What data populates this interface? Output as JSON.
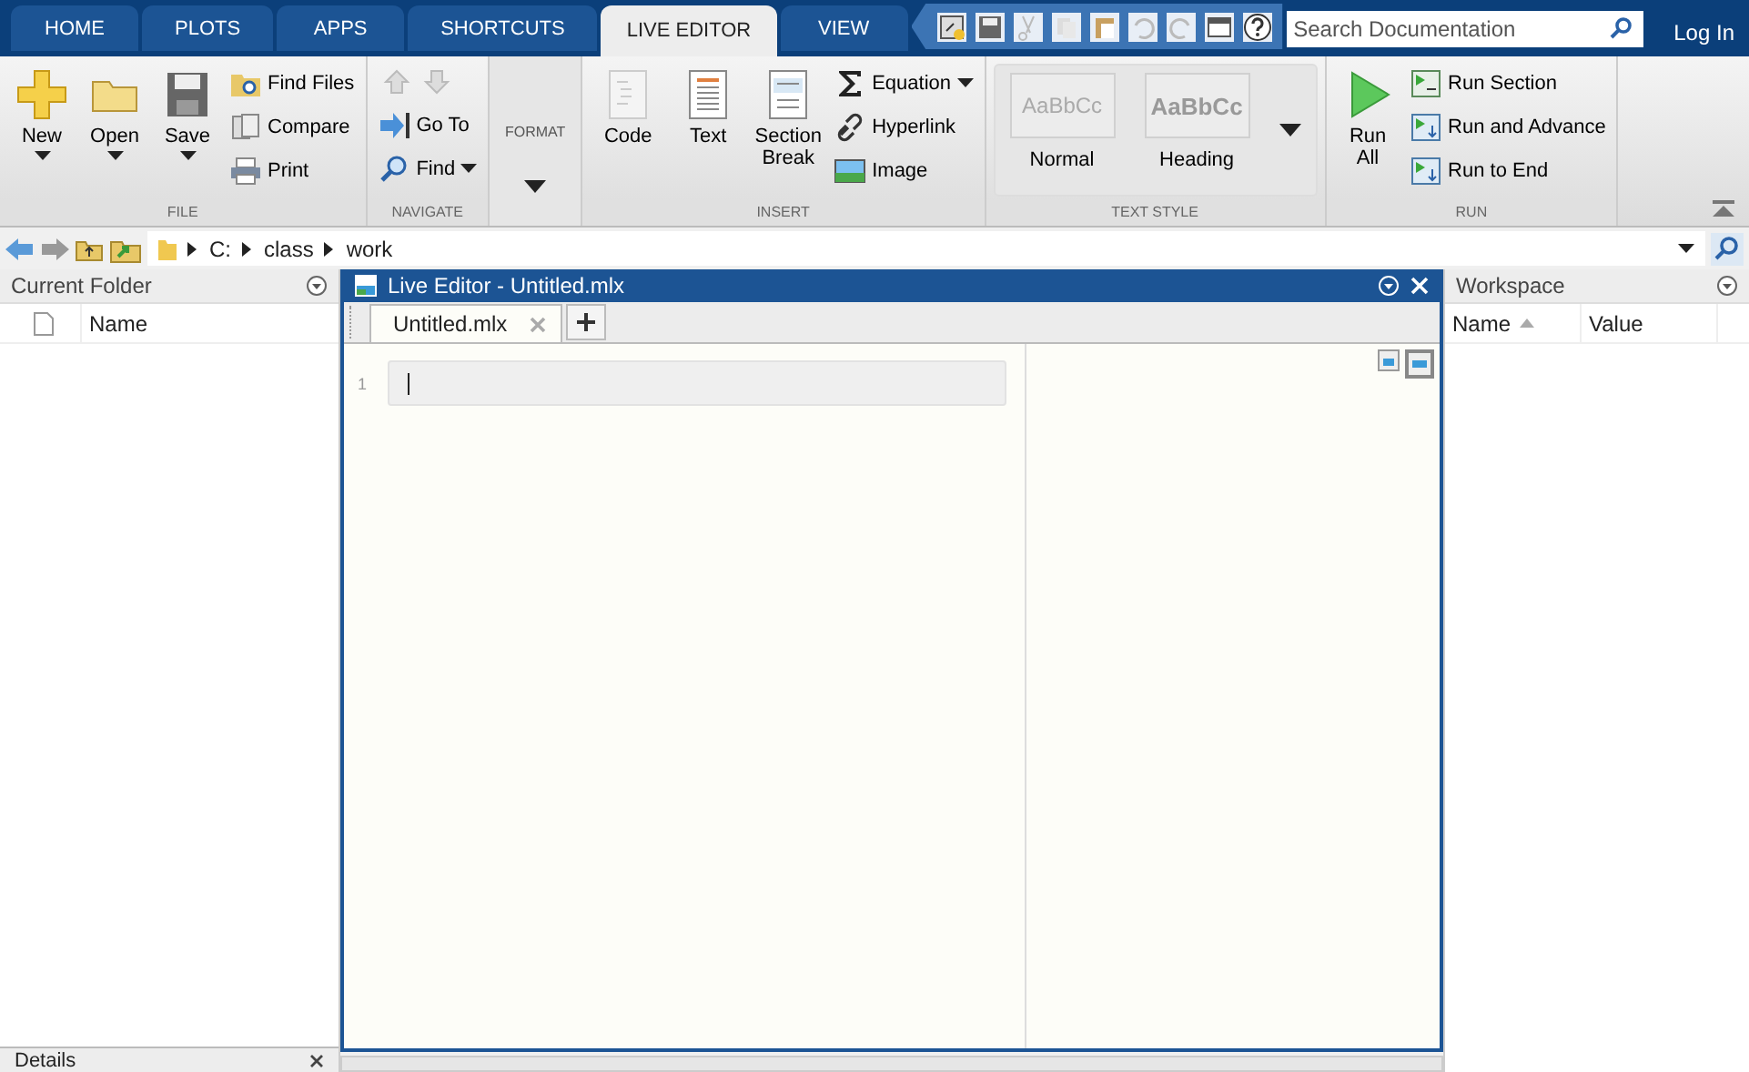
{
  "tabs": [
    {
      "label": "HOME",
      "selected": false
    },
    {
      "label": "PLOTS",
      "selected": false
    },
    {
      "label": "APPS",
      "selected": false
    },
    {
      "label": "SHORTCUTS",
      "selected": false
    },
    {
      "label": "LIVE EDITOR",
      "selected": true
    },
    {
      "label": "VIEW",
      "selected": false
    }
  ],
  "search": {
    "placeholder": "Search Documentation"
  },
  "login": "Log In",
  "ribbon": {
    "groups": [
      {
        "kind": "file",
        "title": "FILE",
        "large": [
          {
            "label": "New",
            "dropdown": true
          },
          {
            "label": "Open",
            "dropdown": true
          },
          {
            "label": "Save",
            "dropdown": true
          }
        ],
        "small": [
          {
            "label": "Find Files",
            "dropdown": false
          },
          {
            "label": "Compare",
            "dropdown": false
          },
          {
            "label": "Print",
            "dropdown": false
          }
        ]
      },
      {
        "kind": "navigate",
        "title": "NAVIGATE",
        "small": [
          {
            "label": "Go To",
            "dropdown": false
          },
          {
            "label": "Find",
            "dropdown": true
          }
        ]
      },
      {
        "kind": "format",
        "label": "FORMAT"
      },
      {
        "kind": "insert",
        "title": "INSERT",
        "large": [
          {
            "label": "Code",
            "dropdown": false
          },
          {
            "label": "Text",
            "dropdown": false
          },
          {
            "label": "Section Break",
            "dropdown": false
          }
        ],
        "small": [
          {
            "label": "Equation",
            "dropdown": true
          },
          {
            "label": "Hyperlink",
            "dropdown": false
          },
          {
            "label": "Image",
            "dropdown": false
          }
        ]
      },
      {
        "kind": "text_style",
        "title": "TEXT STYLE",
        "styles": [
          {
            "sample": "AaBbCc",
            "label": "Normal"
          },
          {
            "sample": "AaBbCc",
            "label": "Heading"
          }
        ]
      },
      {
        "kind": "run",
        "title": "RUN",
        "large": [
          {
            "label": "Run All",
            "dropdown": false
          }
        ],
        "small": [
          {
            "label": "Run Section",
            "dropdown": false
          },
          {
            "label": "Run and Advance",
            "dropdown": false
          },
          {
            "label": "Run to End",
            "dropdown": false
          }
        ]
      }
    ]
  },
  "address": {
    "path": [
      "C:",
      "class",
      "work"
    ]
  },
  "current_folder": {
    "title": "Current Folder",
    "columns": [
      "Name"
    ]
  },
  "details": {
    "title": "Details"
  },
  "editor": {
    "title": "Live Editor - Untitled.mlx",
    "tabs": [
      {
        "label": "Untitled.mlx",
        "selected": true
      }
    ],
    "line_numbers": [
      "1"
    ]
  },
  "workspace": {
    "title": "Workspace",
    "columns": [
      "Name",
      "Value"
    ]
  }
}
